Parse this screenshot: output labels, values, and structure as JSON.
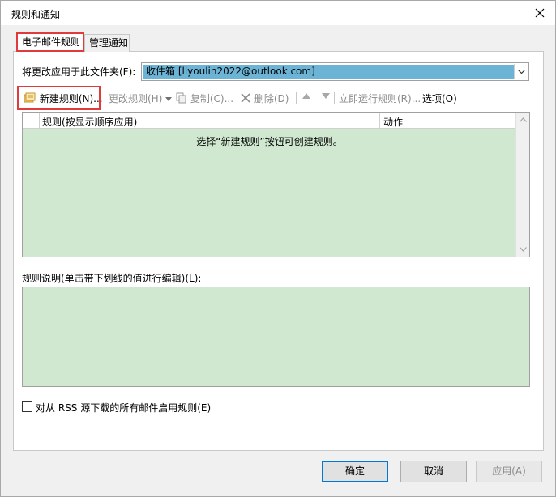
{
  "window": {
    "title": "规则和通知"
  },
  "tabs": [
    {
      "label": "电子邮件规则",
      "active": true
    },
    {
      "label": "管理通知",
      "active": false
    }
  ],
  "folder": {
    "label": "将更改应用于此文件夹(F):",
    "value": "收件箱 [liyoulin2022@outlook.com]"
  },
  "toolbar": {
    "new_rule": "新建规则(N)...",
    "edit_rule": "更改规则(H)",
    "copy": "复制(C)...",
    "delete": "删除(D)",
    "run_now": "立即运行规则(R)...",
    "options": "选项(O)"
  },
  "rule_list": {
    "columns": [
      "规则(按显示顺序应用)",
      "动作"
    ],
    "empty_message": "选择“新建规则”按钮可创建规则。"
  },
  "description": {
    "label": "规则说明(单击带下划线的值进行编辑)(L):"
  },
  "rss_checkbox": {
    "label": "对从 RSS 源下载的所有邮件启用规则(E)",
    "checked": false
  },
  "buttons": {
    "ok": "确定",
    "cancel": "取消",
    "apply": "应用(A)"
  },
  "colors": {
    "highlight": "#e03a3a",
    "list_bg": "#cfe8cf",
    "selected_bg": "#6cb4d6",
    "primary_border": "#0078d7"
  }
}
